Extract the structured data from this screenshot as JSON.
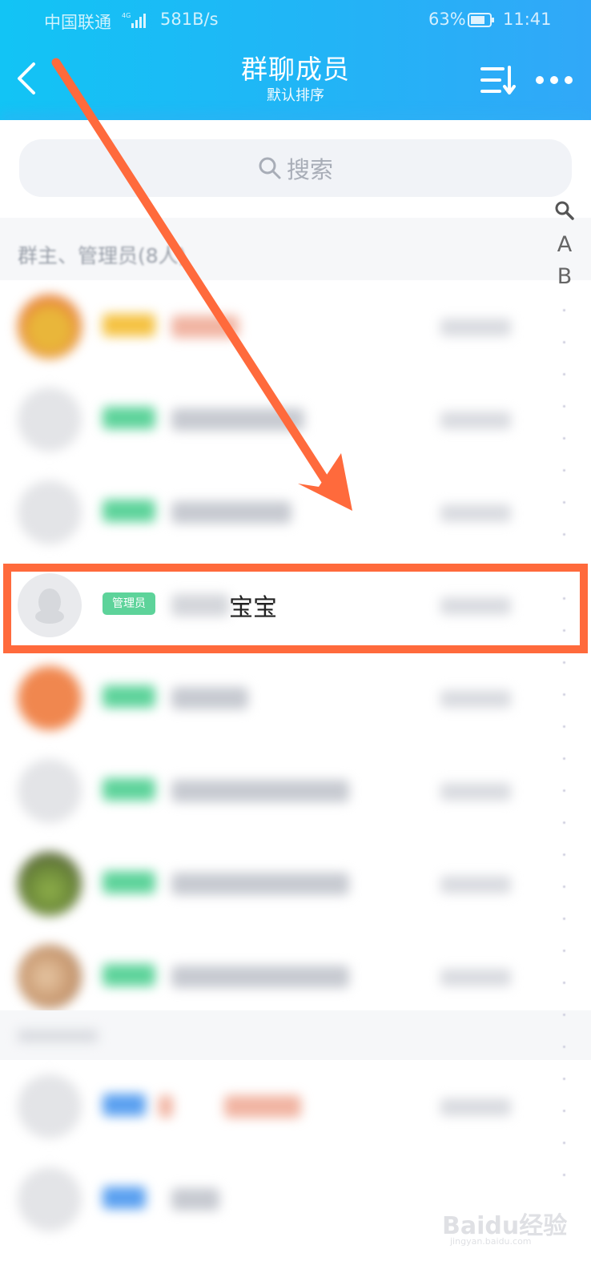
{
  "status_bar": {
    "carrier": "中国联通",
    "network_type": "4G",
    "speed": "581B/s",
    "battery": "63%",
    "time": "11:41"
  },
  "header": {
    "title": "群聊成员",
    "subtitle": "默认排序",
    "back_icon": "chevron-left-icon",
    "sort_icon": "sort-icon",
    "more_icon": "more-dots-icon"
  },
  "search": {
    "placeholder": "搜索",
    "icon": "search-icon"
  },
  "index_bar": {
    "search_icon": "search-icon",
    "letters": [
      "A",
      "B"
    ]
  },
  "section": {
    "title": "群主、管理员(8人)"
  },
  "highlighted_member": {
    "badge": "管理员",
    "name_visible": "宝宝"
  },
  "watermark": {
    "text": "Baidu经验",
    "sub": "jingyan.baidu.com"
  },
  "colors": {
    "header_start": "#12c4f5",
    "header_end": "#31a8f8",
    "admin_badge": "#5dd39a",
    "owner_badge": "#f5c242",
    "highlight": "#ff6a3c"
  }
}
